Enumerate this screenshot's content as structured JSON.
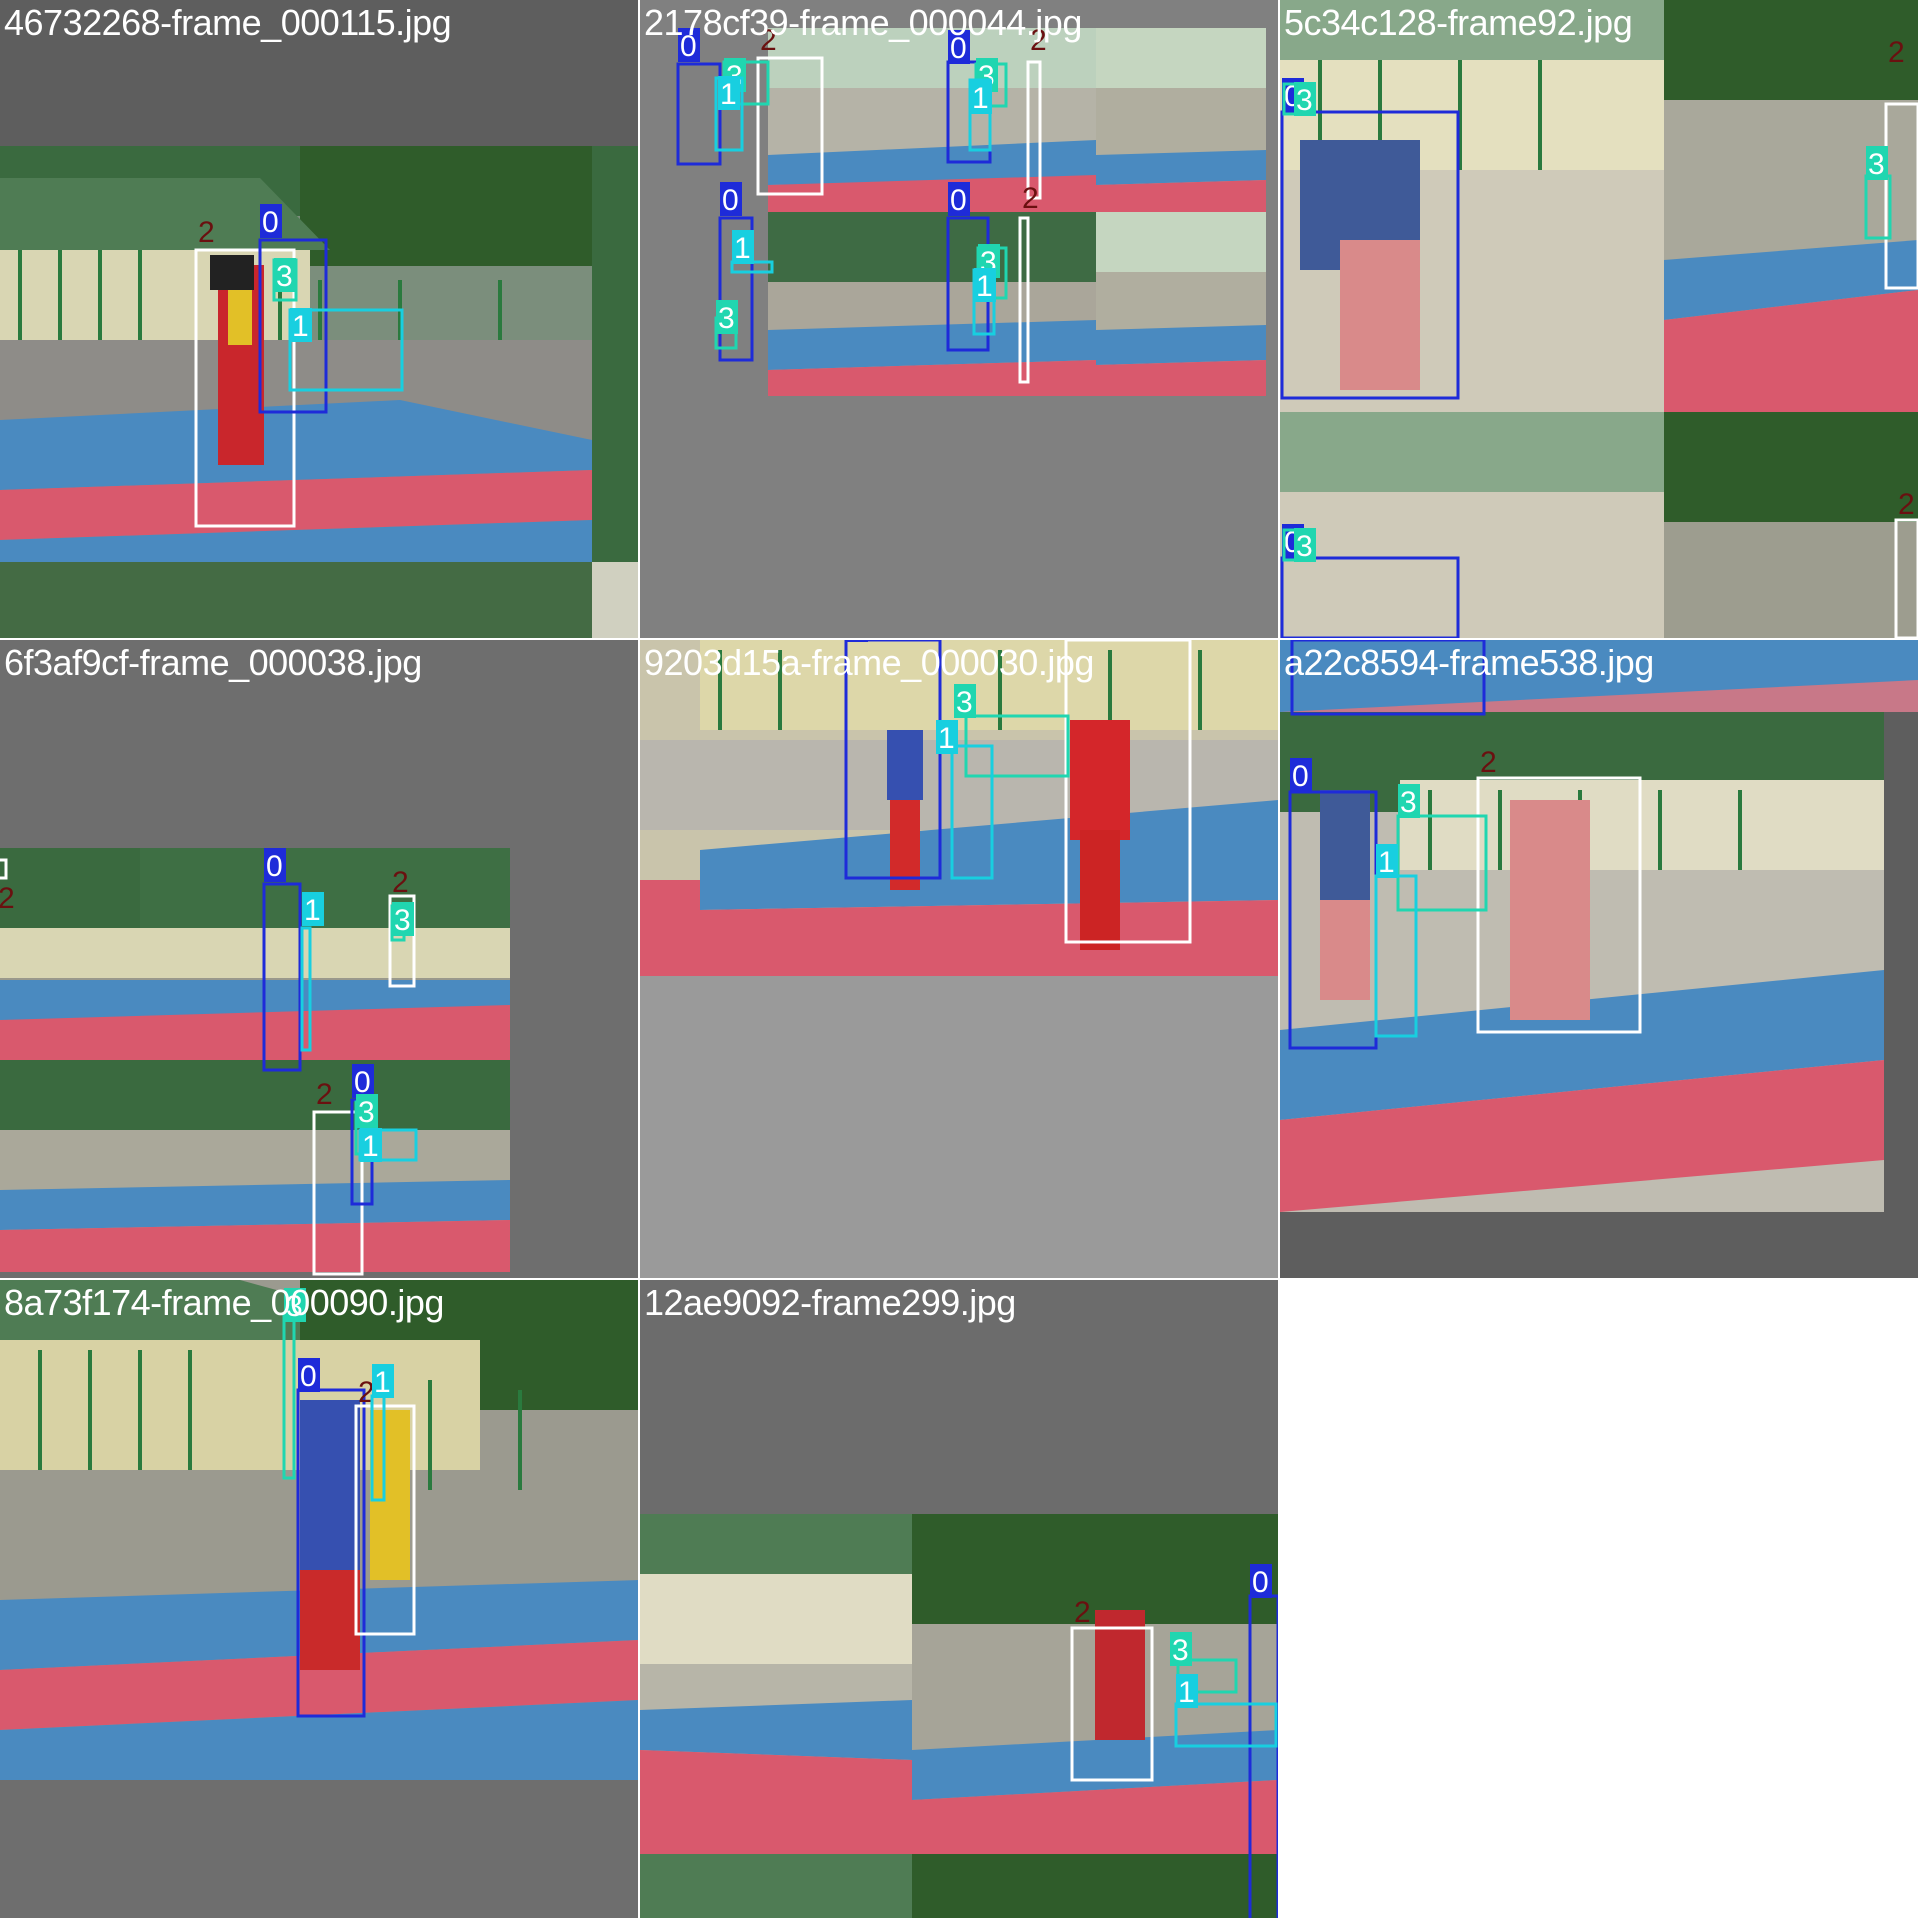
{
  "mosaic": {
    "class_colors": {
      "0": "#1e2bd9",
      "1": "#18cfe0",
      "2": "#ffffff",
      "3": "#20d6b0"
    },
    "label_text_colors": {
      "0": "#ffffff",
      "1": "#ffffff",
      "2": "#6a1010",
      "3": "#ffffff"
    },
    "tiles": [
      {
        "filename": "46732268-frame_000115.jpg",
        "boxes": [
          {
            "cls": "2",
            "label": "2"
          },
          {
            "cls": "0",
            "label": "0"
          },
          {
            "cls": "3",
            "label": "3"
          },
          {
            "cls": "1",
            "label": "1"
          }
        ]
      },
      {
        "filename": "2178cf39-frame_000044.jpg",
        "boxes": [
          {
            "cls": "0",
            "label": "0"
          },
          {
            "cls": "2",
            "label": "2"
          },
          {
            "cls": "3",
            "label": "3"
          },
          {
            "cls": "1",
            "label": "1"
          },
          {
            "cls": "0",
            "label": "0"
          },
          {
            "cls": "2",
            "label": "2"
          },
          {
            "cls": "3",
            "label": "3"
          },
          {
            "cls": "1",
            "label": "1"
          },
          {
            "cls": "0",
            "label": "0"
          },
          {
            "cls": "1",
            "label": "1"
          },
          {
            "cls": "3",
            "label": "3"
          },
          {
            "cls": "0",
            "label": "0"
          },
          {
            "cls": "2",
            "label": "2"
          },
          {
            "cls": "3",
            "label": "3"
          },
          {
            "cls": "1",
            "label": "1"
          }
        ]
      },
      {
        "filename": "5c34c128-frame92.jpg",
        "boxes": [
          {
            "cls": "0",
            "label": "0"
          },
          {
            "cls": "3",
            "label": "3"
          },
          {
            "cls": "2",
            "label": "2"
          },
          {
            "cls": "3",
            "label": "3"
          },
          {
            "cls": "0",
            "label": "0"
          },
          {
            "cls": "3",
            "label": "3"
          },
          {
            "cls": "2",
            "label": "2"
          }
        ]
      },
      {
        "filename": "6f3af9cf-frame_000038.jpg",
        "boxes": [
          {
            "cls": "2",
            "label": "2"
          },
          {
            "cls": "0",
            "label": "0"
          },
          {
            "cls": "1",
            "label": "1"
          },
          {
            "cls": "2",
            "label": "2"
          },
          {
            "cls": "3",
            "label": "3"
          },
          {
            "cls": "2",
            "label": "2"
          },
          {
            "cls": "0",
            "label": "0"
          },
          {
            "cls": "3",
            "label": "3"
          },
          {
            "cls": "1",
            "label": "1"
          }
        ]
      },
      {
        "filename": "9203d15a-frame_000030.jpg",
        "boxes": [
          {
            "cls": "0",
            "label": "0"
          },
          {
            "cls": "2",
            "label": "2"
          },
          {
            "cls": "3",
            "label": "3"
          },
          {
            "cls": "1",
            "label": "1"
          }
        ]
      },
      {
        "filename": "a22c8594-frame538.jpg",
        "boxes": [
          {
            "cls": "0",
            "label": "0"
          },
          {
            "cls": "0",
            "label": "0"
          },
          {
            "cls": "2",
            "label": "2"
          },
          {
            "cls": "3",
            "label": "3"
          },
          {
            "cls": "1",
            "label": "1"
          }
        ]
      },
      {
        "filename": "8a73f174-frame_000090.jpg",
        "boxes": [
          {
            "cls": "3",
            "label": "3"
          },
          {
            "cls": "0",
            "label": "0"
          },
          {
            "cls": "2",
            "label": "2"
          },
          {
            "cls": "1",
            "label": "1"
          }
        ]
      },
      {
        "filename": "12ae9092-frame299.jpg",
        "boxes": [
          {
            "cls": "2",
            "label": "2"
          },
          {
            "cls": "0",
            "label": "0"
          },
          {
            "cls": "3",
            "label": "3"
          },
          {
            "cls": "1",
            "label": "1"
          }
        ]
      }
    ]
  }
}
